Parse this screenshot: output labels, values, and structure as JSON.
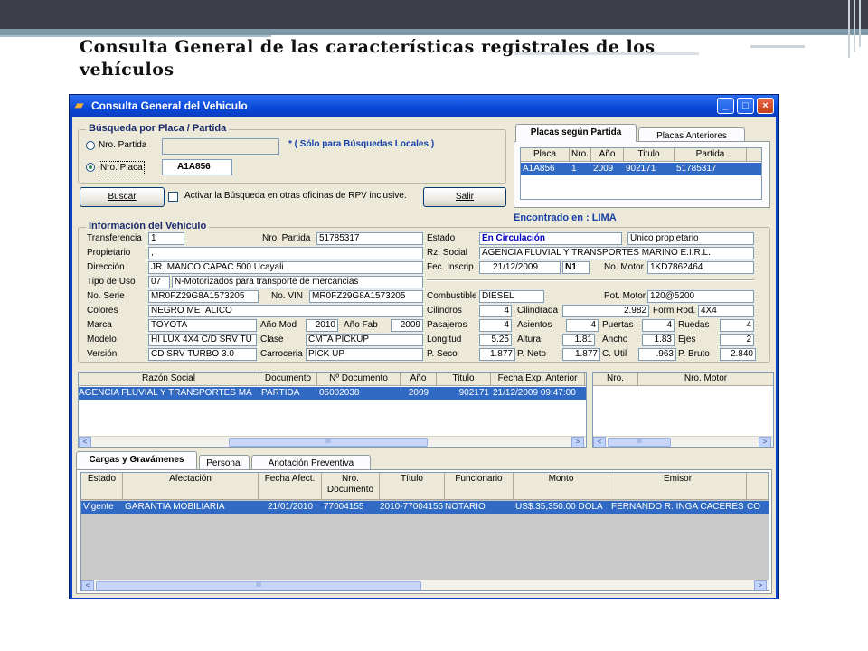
{
  "slide_title": "Consulta General de las características registrales de los vehículos",
  "window": {
    "title": "Consulta General del Vehiculo",
    "min": "_",
    "max": "□",
    "close": "×"
  },
  "busqueda": {
    "legend": "Búsqueda por Placa / Partida",
    "opt_partida": "Nro. Partida",
    "opt_placa": "Nro. Placa",
    "partida_value": "",
    "placa_value": "A1A856",
    "note": "* ( Sólo para Búsquedas Locales )",
    "buscar": "Buscar",
    "checkbox_label": "Activar la Búsqueda en otras oficinas de RPV inclusive.",
    "salir": "Salir"
  },
  "placas": {
    "tab_active": "Placas según Partida",
    "tab_other": "Placas Anteriores",
    "headers": [
      "Placa",
      "Nro.",
      "Año",
      "Titulo",
      "Partida"
    ],
    "row": [
      "A1A856",
      "1",
      "2009",
      "902171",
      "51785317"
    ],
    "found": "Encontrado en : LIMA"
  },
  "info": {
    "legend": "Información del Vehículo",
    "transferencia_lbl": "Transferencia",
    "transferencia": "1",
    "nro_partida_lbl": "Nro. Partida",
    "nro_partida": "51785317",
    "propietario_lbl": "Propietario",
    "propietario": ",",
    "direccion_lbl": "Dirección",
    "direccion": "JR. MANCO CAPAC 500 Ucayali",
    "tipo_uso_lbl": "Tipo de Uso",
    "tipo_uso_code": "07",
    "tipo_uso": "N-Motorizados para transporte de mercancias",
    "nro_serie_lbl": "No. Serie",
    "nro_serie": "MR0FZ29G8A1573205",
    "nro_vin_lbl": "No. VIN",
    "nro_vin": "MR0FZ29G8A1573205",
    "colores_lbl": "Colores",
    "colores": "NEGRO METALICO",
    "marca_lbl": "Marca",
    "marca": "TOYOTA",
    "anio_mod_lbl": "Año Mod",
    "anio_mod": "2010",
    "anio_fab_lbl": "Año Fab",
    "anio_fab": "2009",
    "modelo_lbl": "Modelo",
    "modelo": "HI LUX 4X4 C/D SRV TU",
    "clase_lbl": "Clase",
    "clase": "CMTA PICKUP",
    "version_lbl": "Versión",
    "version": "CD SRV TURBO 3.0",
    "carroceria_lbl": "Carroceria",
    "carroceria": "PICK UP",
    "estado_lbl": "Estado",
    "estado": "En Circulación",
    "estado2": "Único propietario",
    "rz_social_lbl": "Rz. Social",
    "rz_social": "AGENCIA FLUVIAL Y TRANSPORTES MARIÑO E.I.R.L.",
    "fec_inscrip_lbl": "Fec. Inscrip",
    "fec_inscrip": "21/12/2009",
    "n1": "N1",
    "nro_motor_lbl": "No. Motor",
    "nro_motor": "1KD7862464",
    "combustible_lbl": "Combustible",
    "combustible": "DIESEL",
    "pot_motor_lbl": "Pot. Motor",
    "pot_motor": "120@5200",
    "cilindros_lbl": "Cilindros",
    "cilindros": "4",
    "cilindrada_lbl": "Cilindrada",
    "cilindrada": "2.982",
    "form_rod_lbl": "Form Rod.",
    "form_rod": "4X4",
    "pasajeros_lbl": "Pasajeros",
    "pasajeros": "4",
    "asientos_lbl": "Asientos",
    "asientos": "4",
    "puertas_lbl": "Puertas",
    "puertas": "4",
    "ruedas_lbl": "Ruedas",
    "ruedas": "4",
    "longitud_lbl": "Longitud",
    "longitud": "5.25",
    "altura_lbl": "Altura",
    "altura": "1.81",
    "ancho_lbl": "Ancho",
    "ancho": "1.83",
    "ejes_lbl": "Ejes",
    "ejes": "2",
    "p_seco_lbl": "P. Seco",
    "p_seco": "1.877",
    "p_neto_lbl": "P. Neto",
    "p_neto": "1.877",
    "c_util_lbl": "C. Util",
    "c_util": ".963",
    "p_bruto_lbl": "P. Bruto",
    "p_bruto": "2.840"
  },
  "propietarios": {
    "headers": [
      "Razón Social",
      "Documento",
      "Nº Documento",
      "Año",
      "Titulo",
      "Fecha Exp. Anterior"
    ],
    "row": [
      "AGENCIA FLUVIAL Y TRANSPORTES MA",
      "PARTIDA",
      "05002038",
      "2009",
      "902171",
      "21/12/2009 09:47:00"
    ]
  },
  "motores": {
    "headers": [
      "Nro.",
      "Nro. Motor"
    ]
  },
  "cargas": {
    "tabs": [
      "Cargas y Gravámenes",
      "Personal",
      "Anotación Preventiva"
    ],
    "headers": [
      "Estado",
      "Afectación",
      "Fecha Afect.",
      "Nro. Documento",
      "Título",
      "Funcionario",
      "Monto",
      "Emisor"
    ],
    "row": [
      "Vigente",
      "GARANTIA MOBILIARIA",
      "21/01/2010",
      "77004155",
      "2010-77004155",
      "NOTARIO",
      "US$.35,350.00 DOLA",
      "FERNANDO R. INGA CACERES",
      "CO"
    ]
  },
  "scroll": {
    "left": "<",
    "right": ">",
    "thumb": "III"
  }
}
